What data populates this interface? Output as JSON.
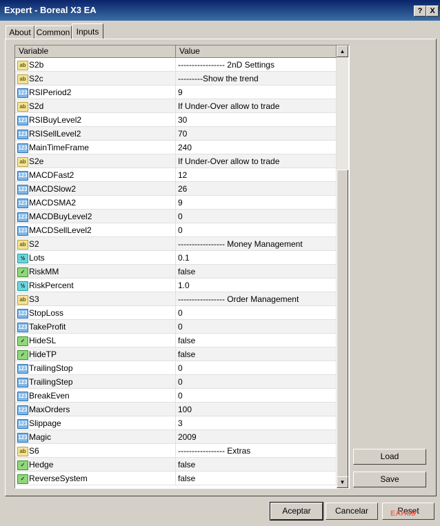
{
  "window": {
    "title": "Expert - Boreal X3 EA",
    "help": "?",
    "close": "X"
  },
  "tabs": [
    {
      "label": "About"
    },
    {
      "label": "Common"
    },
    {
      "label": "Inputs"
    }
  ],
  "grid": {
    "columns": {
      "variable": "Variable",
      "value": "Value"
    },
    "rows": [
      {
        "icon": "str",
        "name": "S2b",
        "value": "----------------- 2nD Settings"
      },
      {
        "icon": "str",
        "name": "S2c",
        "value": "---------Show the trend"
      },
      {
        "icon": "int",
        "name": "RSIPeriod2",
        "value": "9"
      },
      {
        "icon": "str",
        "name": "S2d",
        "value": "If Under-Over allow to trade"
      },
      {
        "icon": "int",
        "name": "RSIBuyLevel2",
        "value": "30"
      },
      {
        "icon": "int",
        "name": "RSISellLevel2",
        "value": "70"
      },
      {
        "icon": "int",
        "name": "MainTimeFrame",
        "value": "240"
      },
      {
        "icon": "str",
        "name": "S2e",
        "value": "If Under-Over allow to trade"
      },
      {
        "icon": "int",
        "name": "MACDFast2",
        "value": "12"
      },
      {
        "icon": "int",
        "name": "MACDSlow2",
        "value": "26"
      },
      {
        "icon": "int",
        "name": "MACDSMA2",
        "value": "9"
      },
      {
        "icon": "int",
        "name": "MACDBuyLevel2",
        "value": "0"
      },
      {
        "icon": "int",
        "name": "MACDSellLevel2",
        "value": "0"
      },
      {
        "icon": "str",
        "name": "S2",
        "value": "----------------- Money Management"
      },
      {
        "icon": "dbl",
        "name": "Lots",
        "value": "0.1"
      },
      {
        "icon": "bool",
        "name": "RiskMM",
        "value": "false"
      },
      {
        "icon": "dbl",
        "name": "RiskPercent",
        "value": "1.0"
      },
      {
        "icon": "str",
        "name": "S3",
        "value": "----------------- Order Management"
      },
      {
        "icon": "int",
        "name": "StopLoss",
        "value": "0"
      },
      {
        "icon": "int",
        "name": "TakeProfit",
        "value": "0"
      },
      {
        "icon": "bool",
        "name": "HideSL",
        "value": "false"
      },
      {
        "icon": "bool",
        "name": "HideTP",
        "value": "false"
      },
      {
        "icon": "int",
        "name": "TrailingStop",
        "value": "0"
      },
      {
        "icon": "int",
        "name": "TrailingStep",
        "value": "0"
      },
      {
        "icon": "int",
        "name": "BreakEven",
        "value": "0"
      },
      {
        "icon": "int",
        "name": "MaxOrders",
        "value": "100"
      },
      {
        "icon": "int",
        "name": "Slippage",
        "value": "3"
      },
      {
        "icon": "int",
        "name": "Magic",
        "value": "2009"
      },
      {
        "icon": "str",
        "name": "S6",
        "value": "----------------- Extras"
      },
      {
        "icon": "bool",
        "name": "Hedge",
        "value": "false"
      },
      {
        "icon": "bool",
        "name": "ReverseSystem",
        "value": "false"
      }
    ]
  },
  "icons": {
    "str": "ab",
    "int": "123",
    "dbl": "½",
    "bool": "✓"
  },
  "side_buttons": {
    "load": "Load",
    "save": "Save"
  },
  "footer": {
    "accept": "Aceptar",
    "cancel": "Cancelar",
    "reset": "Reset"
  },
  "watermark": "EAHub"
}
